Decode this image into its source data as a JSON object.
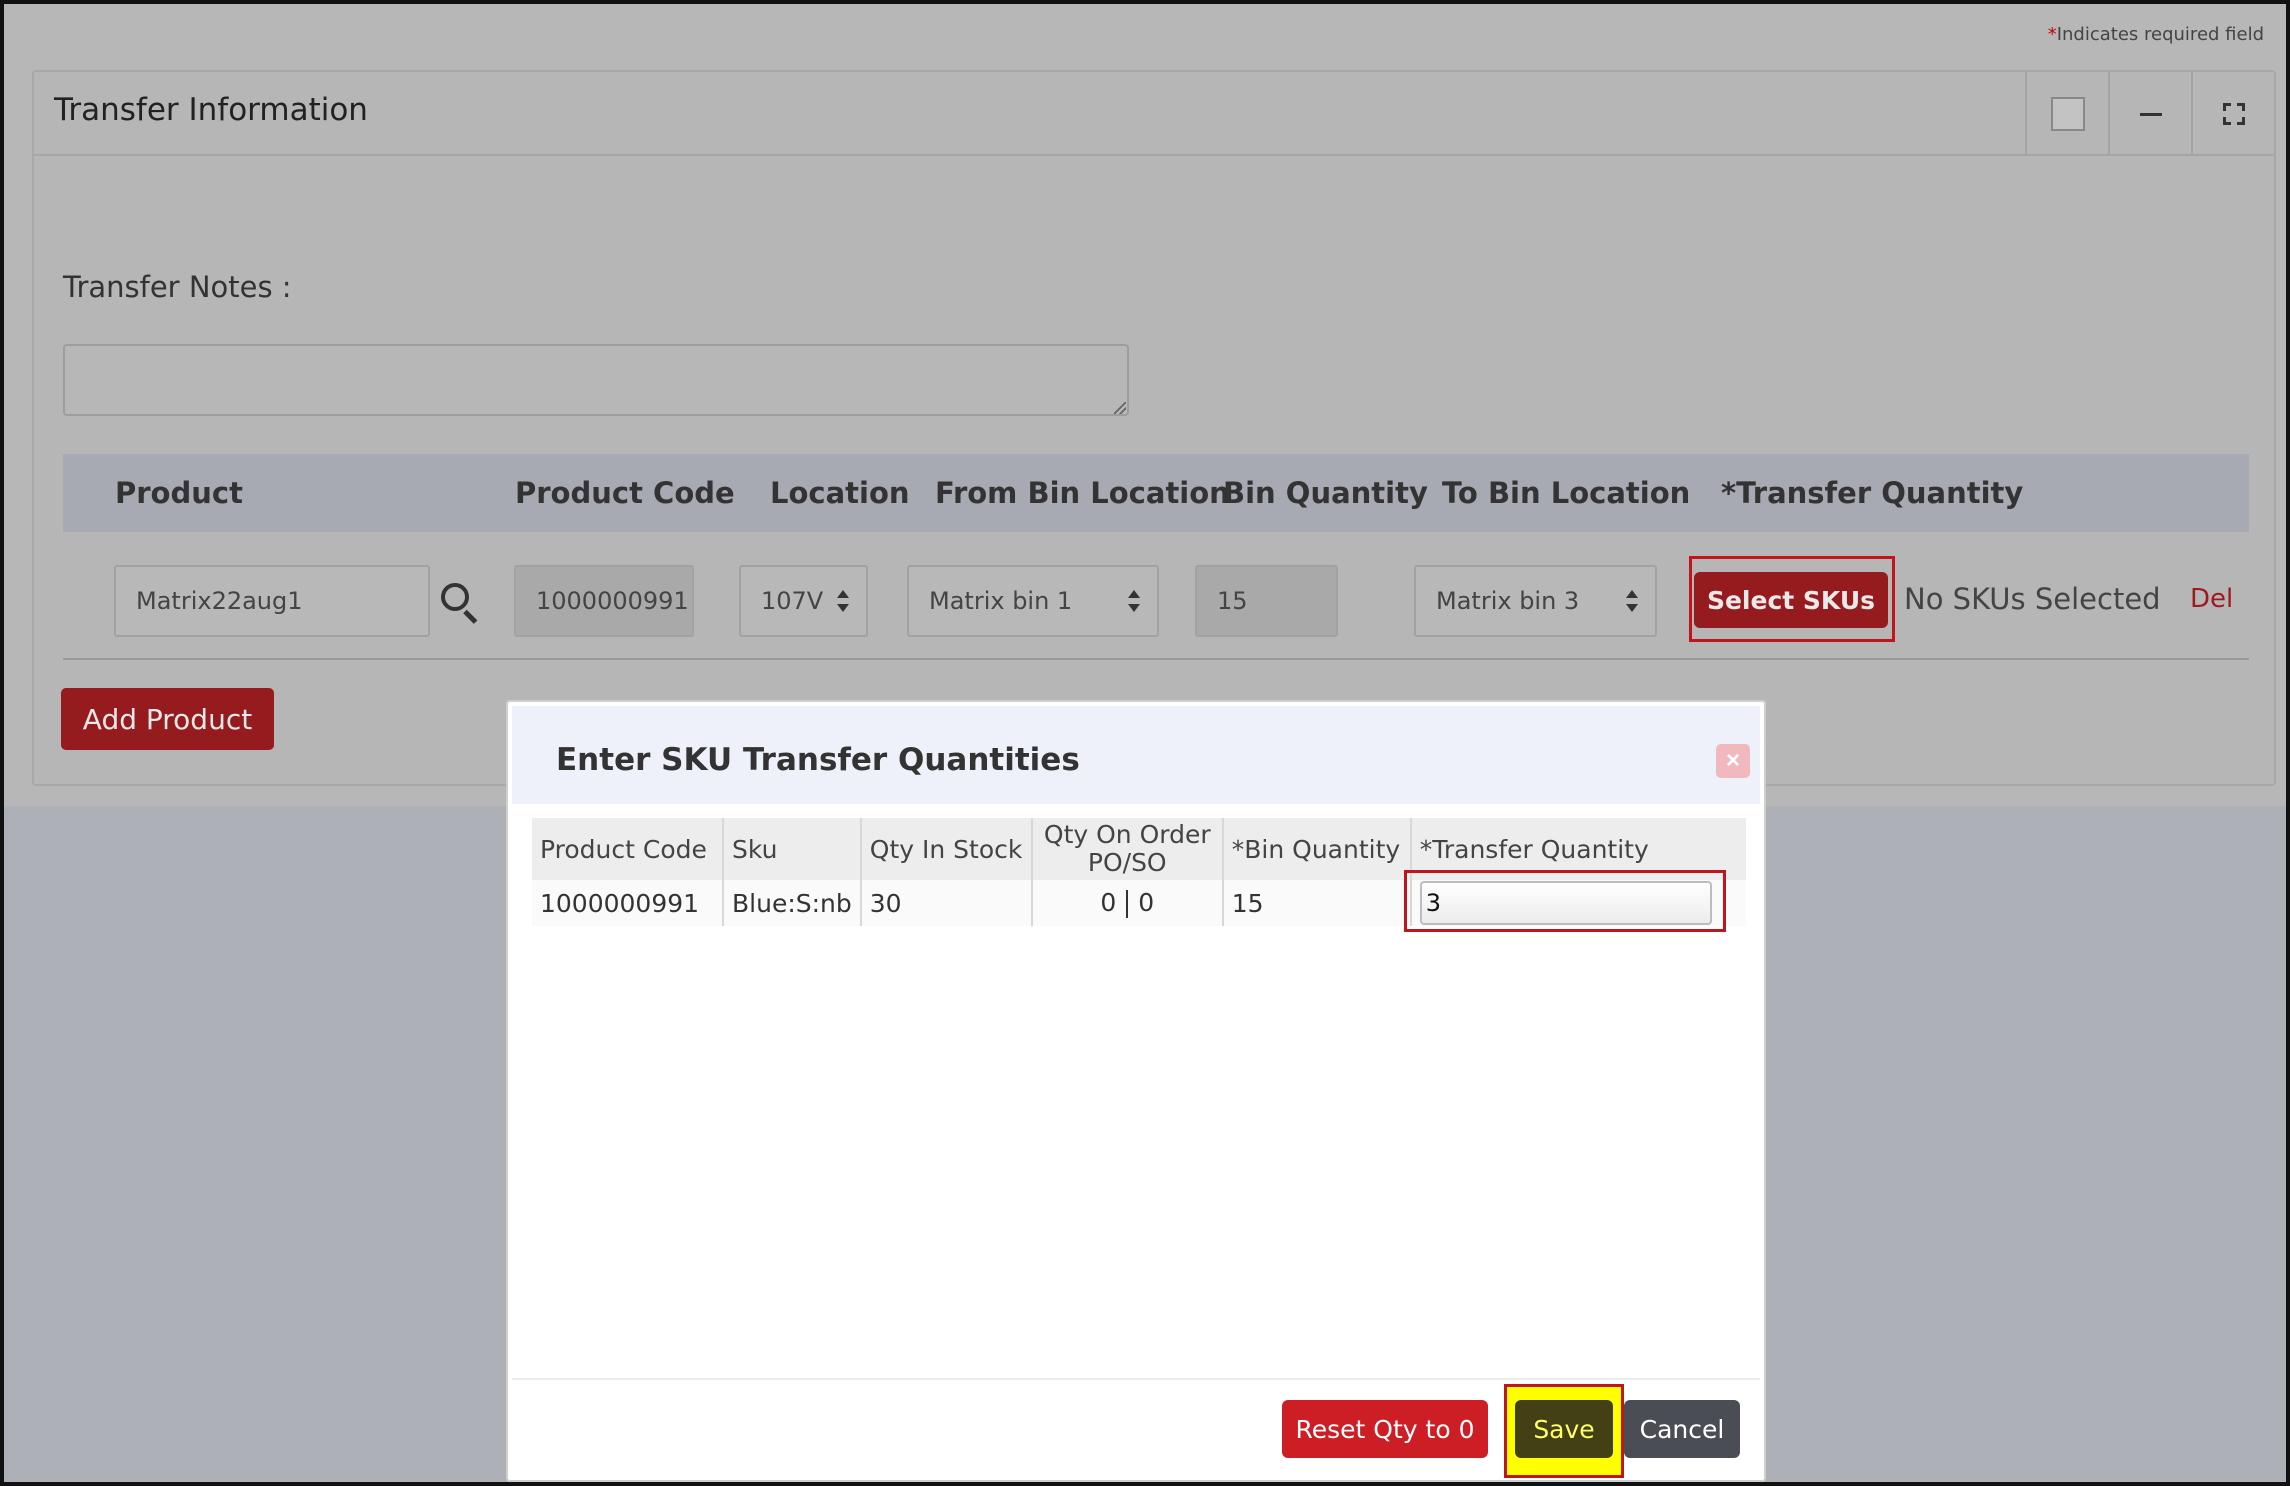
{
  "required_note": {
    "star": "*",
    "text": "Indicates required field"
  },
  "panel": {
    "title": "Transfer Information",
    "notes_label": "Transfer Notes :",
    "notes_value": ""
  },
  "product_table": {
    "headers": [
      "Product",
      "Product Code",
      "Location",
      "From Bin Location",
      "Bin Quantity",
      "To Bin Location",
      "*Transfer Quantity"
    ],
    "row": {
      "product": "Matrix22aug1",
      "product_code": "1000000991",
      "location": "107V",
      "from_bin": "Matrix bin 1",
      "bin_quantity": "15",
      "to_bin": "Matrix bin 3",
      "select_skus_label": "Select SKUs",
      "sku_status": "No SKUs Selected",
      "delete_label": "Del"
    },
    "add_product_label": "Add Product"
  },
  "modal": {
    "title": "Enter SKU Transfer Quantities",
    "close_glyph": "×",
    "headers": {
      "product_code": "Product Code",
      "sku": "Sku",
      "qty_in_stock": "Qty In Stock",
      "qty_on_order_line1": "Qty On Order",
      "qty_on_order_line2": "PO/SO",
      "bin_quantity": "*Bin Quantity",
      "transfer_quantity": "*Transfer Quantity"
    },
    "row": {
      "product_code": "1000000991",
      "sku": "Blue:S:nb",
      "qty_in_stock": "30",
      "qty_on_order_po": "0",
      "qty_on_order_so": "0",
      "bin_quantity": "15",
      "transfer_quantity": "3"
    },
    "buttons": {
      "reset": "Reset Qty to 0",
      "save": "Save",
      "cancel": "Cancel"
    }
  }
}
